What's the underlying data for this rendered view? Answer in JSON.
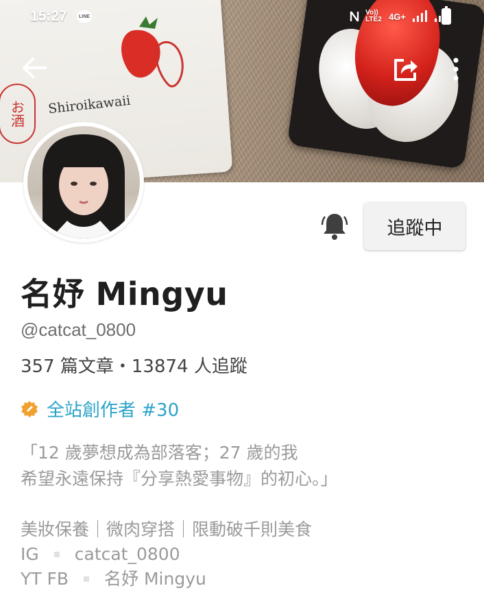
{
  "status_bar": {
    "time": "15:27",
    "line_label": "LINE",
    "volte_label": "Vo)) LTE2",
    "network_label": "4G+"
  },
  "cover": {
    "sake_stamp": "お酒",
    "brand_text": "Shiroikawaii"
  },
  "profile": {
    "display_name": "名妤 Mingyu",
    "handle": "@catcat_0800",
    "stats": "357 篇文章・13874 人追蹤",
    "badge_text": "全站創作者 #30",
    "follow_button_label": "追蹤中",
    "bio_lines": [
      "「12 歲夢想成為部落客；27 歲的我",
      "希望永遠保持『分享熱愛事物』的初心。」"
    ],
    "links": {
      "categories": "美妝保養｜微肉穿搭｜限動破千則美食",
      "ig_label": "IG",
      "ig_value": "catcat_0800",
      "ytfb_label": "YT FB",
      "ytfb_value": "名妤 Mingyu"
    }
  },
  "colors": {
    "badge_accent": "#2aa3c7",
    "badge_icon": "#f0a030",
    "follow_bg": "#f2f2f2"
  },
  "icons": {
    "back": "arrow-left-icon",
    "share": "share-icon",
    "more": "more-vertical-icon",
    "bell": "bell-icon",
    "badge": "pen-badge-icon"
  }
}
